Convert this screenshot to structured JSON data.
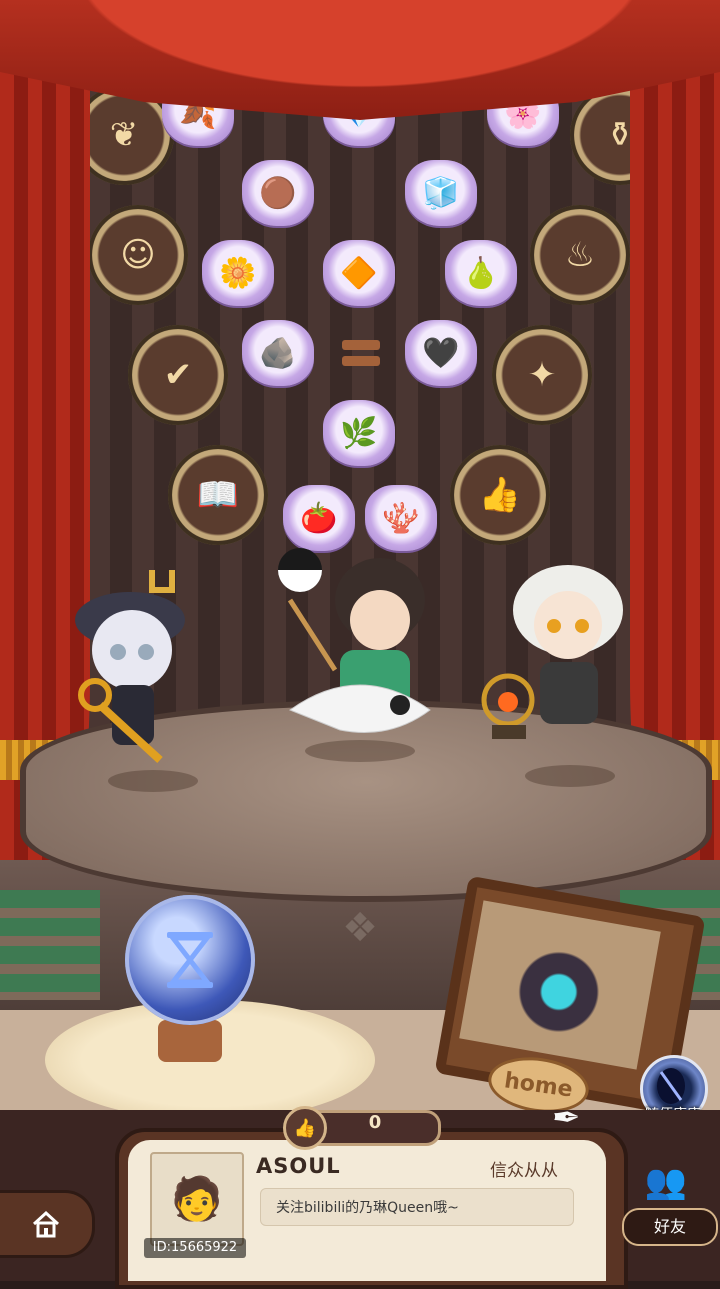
{
  "scene": {
    "ingredients": [
      {
        "name": "golden-leaf",
        "glyph": "🍂",
        "color": "#e6b93a"
      },
      {
        "name": "teal-jewel",
        "glyph": "💎",
        "color": "#49c6c9"
      },
      {
        "name": "purple-flower",
        "glyph": "🌸",
        "color": "#8a5fd6"
      },
      {
        "name": "dirt-pile",
        "glyph": "🪨",
        "color": "#6b4a2a"
      },
      {
        "name": "salt-pile",
        "glyph": "🧂",
        "color": "#bfe4f4"
      },
      {
        "name": "white-lily",
        "glyph": "🌼",
        "color": "#f0f0d0"
      },
      {
        "name": "amber-stone",
        "glyph": "🟫",
        "color": "#b85a22"
      },
      {
        "name": "green-pear",
        "glyph": "🍐",
        "color": "#3aa38a"
      },
      {
        "name": "silver-ore",
        "glyph": "🪨",
        "color": "#dfe4ea"
      },
      {
        "name": "dark-shard",
        "glyph": "◆",
        "color": "#2c2a35"
      },
      {
        "name": "green-herb",
        "glyph": "🌿",
        "color": "#3fa04a"
      },
      {
        "name": "red-tomato",
        "glyph": "🍅",
        "color": "#d63a2a"
      },
      {
        "name": "red-coral",
        "glyph": "🪸",
        "color": "#c23a3a"
      }
    ],
    "medallions": [
      "twig-pattern",
      "cauldron",
      "flame-pot",
      "scroll",
      "fairy",
      "book",
      "thumbs-up",
      "tree"
    ]
  },
  "like": {
    "count": "0"
  },
  "profile": {
    "name": "ASOUL",
    "title": "信众从从",
    "signature": "关注bilibili的乃琳Queen哦~",
    "id": "ID:15665922"
  },
  "home_plate": "home",
  "random_visit": "随便康康",
  "friends": "好友"
}
